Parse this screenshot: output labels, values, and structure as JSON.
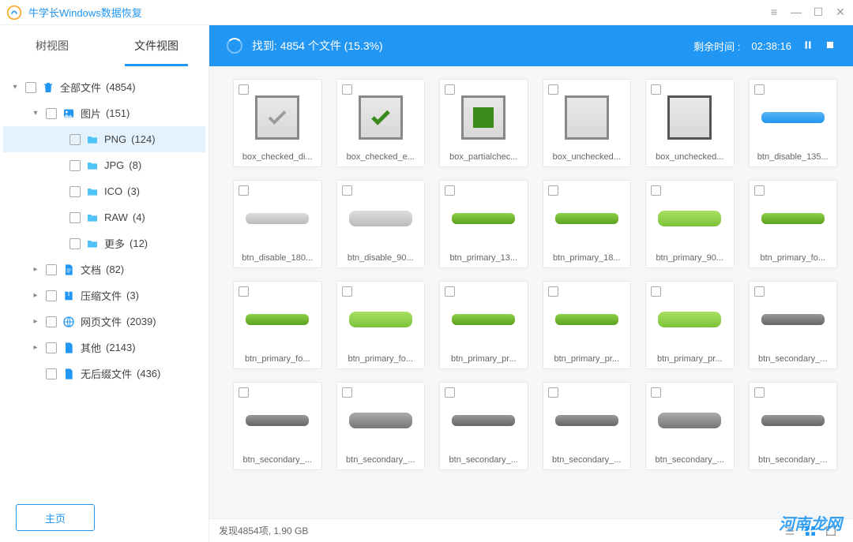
{
  "app": {
    "title": "牛学长Windows数据恢复"
  },
  "tabs": {
    "tree": "树视图",
    "file": "文件视图"
  },
  "tree": {
    "all": {
      "label": "全部文件",
      "count": "(4854)"
    },
    "images": {
      "label": "图片",
      "count": "(151)"
    },
    "png": {
      "label": "PNG",
      "count": "(124)"
    },
    "jpg": {
      "label": "JPG",
      "count": "(8)"
    },
    "ico": {
      "label": "ICO",
      "count": "(3)"
    },
    "raw": {
      "label": "RAW",
      "count": "(4)"
    },
    "more": {
      "label": "更多",
      "count": "(12)"
    },
    "docs": {
      "label": "文档",
      "count": "(82)"
    },
    "zip": {
      "label": "压缩文件",
      "count": "(3)"
    },
    "web": {
      "label": "网页文件",
      "count": "(2039)"
    },
    "other": {
      "label": "其他",
      "count": "(2143)"
    },
    "noext": {
      "label": "无后缀文件",
      "count": "(436)"
    }
  },
  "status": {
    "found_text": "找到: 4854 个文件 (15.3%)",
    "remain_label": "剩余时间 :",
    "remain_value": "02:38:16"
  },
  "files": [
    {
      "name": "box_checked_di..."
    },
    {
      "name": "box_checked_e..."
    },
    {
      "name": "box_partialchec..."
    },
    {
      "name": "box_unchecked..."
    },
    {
      "name": "box_unchecked..."
    },
    {
      "name": "btn_disable_135..."
    },
    {
      "name": "btn_disable_180..."
    },
    {
      "name": "btn_disable_90..."
    },
    {
      "name": "btn_primary_13..."
    },
    {
      "name": "btn_primary_18..."
    },
    {
      "name": "btn_primary_90..."
    },
    {
      "name": "btn_primary_fo..."
    },
    {
      "name": "btn_primary_fo..."
    },
    {
      "name": "btn_primary_fo..."
    },
    {
      "name": "btn_primary_pr..."
    },
    {
      "name": "btn_primary_pr..."
    },
    {
      "name": "btn_primary_pr..."
    },
    {
      "name": "btn_secondary_..."
    },
    {
      "name": "btn_secondary_..."
    },
    {
      "name": "btn_secondary_..."
    },
    {
      "name": "btn_secondary_..."
    },
    {
      "name": "btn_secondary_..."
    },
    {
      "name": "btn_secondary_..."
    },
    {
      "name": "btn_secondary_..."
    }
  ],
  "bottom": {
    "summary": "发现4854项, 1.90 GB"
  },
  "home_btn": "主页",
  "watermark": "河南龙网"
}
